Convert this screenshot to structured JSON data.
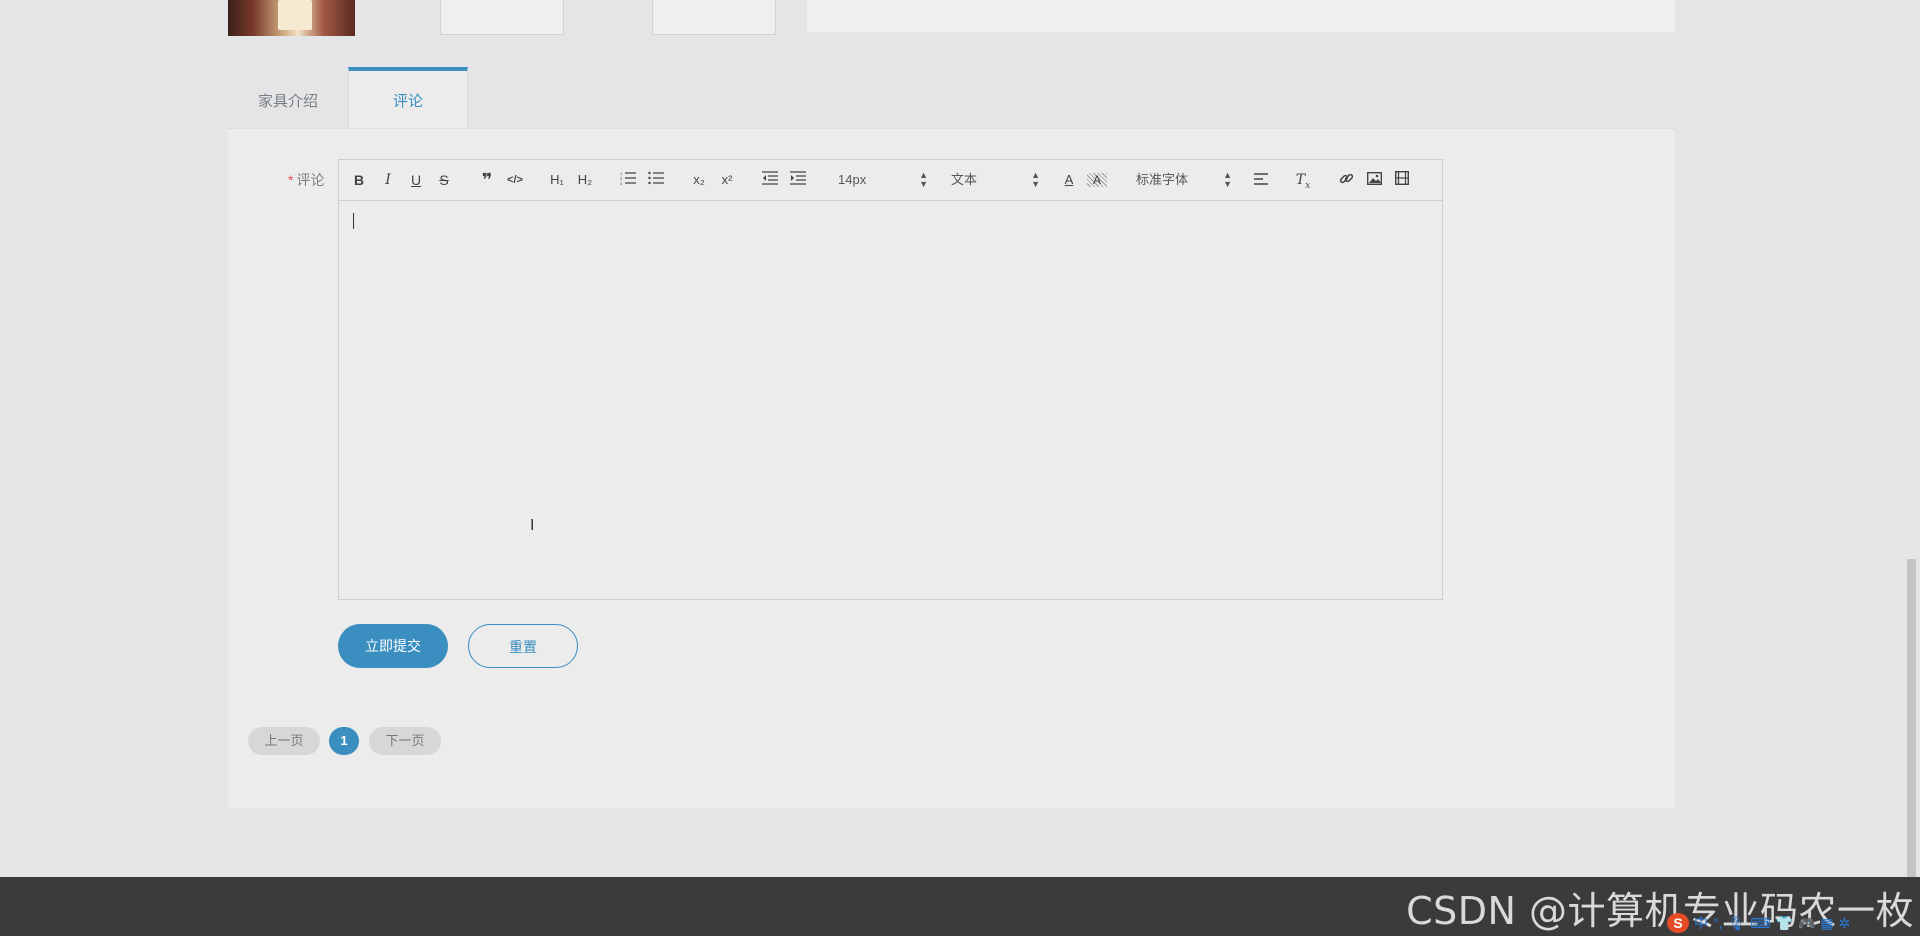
{
  "tabs": [
    {
      "label": "家具介绍",
      "active": false
    },
    {
      "label": "评论",
      "active": true
    }
  ],
  "form": {
    "comment_label": "评论",
    "required_mark": "*"
  },
  "editor": {
    "toolbar": {
      "font_size": "14px",
      "header_select": "文本",
      "font_family": "标准字体",
      "bold": "B",
      "italic": "I",
      "underline": "U",
      "strike": "S",
      "h1": "H₁",
      "h2": "H₂",
      "sub": "x₂",
      "sup": "x²"
    },
    "content": ""
  },
  "buttons": {
    "submit": "立即提交",
    "reset": "重置"
  },
  "pagination": {
    "prev": "上一页",
    "current": "1",
    "next": "下一页"
  },
  "watermark": "CSDN @计算机专业码农一枚",
  "ime": {
    "logo": "S",
    "lang": "中"
  },
  "colors": {
    "accent": "#3a8ec0",
    "required": "#e4484b",
    "footer": "#3b3b3b"
  }
}
